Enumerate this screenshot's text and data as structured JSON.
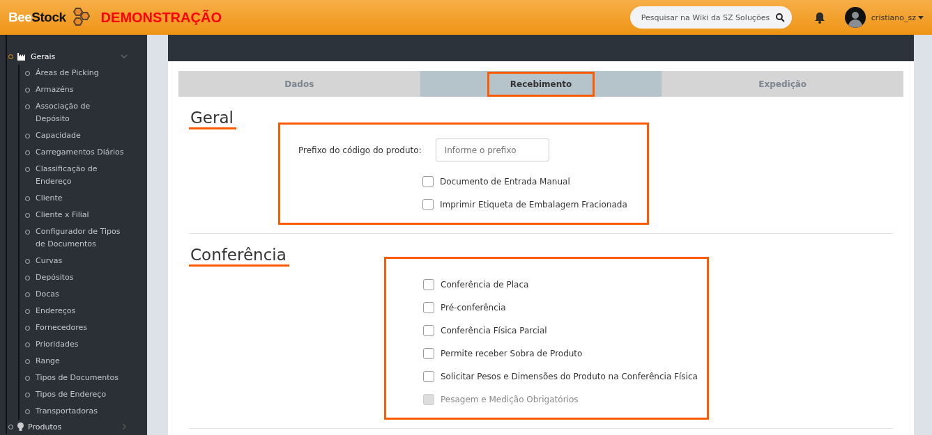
{
  "header": {
    "logo_light": "Bee",
    "logo_dark": "Stock",
    "banner": "DEMONSTRAÇÃO",
    "search": {
      "placeholder": "Pesquisar na Wiki da SZ Soluções"
    },
    "user": "cristiano_sz"
  },
  "sidebar": {
    "group": {
      "label": "Gerais",
      "expanded": true,
      "children": [
        {
          "label": "Áreas de Picking"
        },
        {
          "label": "Armazéns"
        },
        {
          "label": "Associação de Depósito"
        },
        {
          "label": "Capacidade"
        },
        {
          "label": "Carregamentos Diários"
        },
        {
          "label": "Classificação de Endereço"
        },
        {
          "label": "Cliente"
        },
        {
          "label": "Cliente x Filial"
        },
        {
          "label": "Configurador de Tipos de Documentos"
        },
        {
          "label": "Curvas"
        },
        {
          "label": "Depósitos"
        },
        {
          "label": "Docas"
        },
        {
          "label": "Endereços"
        },
        {
          "label": "Fornecedores"
        },
        {
          "label": "Prioridades"
        },
        {
          "label": "Range"
        },
        {
          "label": "Tipos de Documentos"
        },
        {
          "label": "Tipos de Endereço"
        },
        {
          "label": "Transportadoras"
        }
      ]
    },
    "next": {
      "label": "Produtos",
      "expanded": false
    }
  },
  "tabs": [
    {
      "label": "Dados",
      "selected": false,
      "highlighted": false
    },
    {
      "label": "Recebimento",
      "selected": true,
      "highlighted": true
    },
    {
      "label": "Expedição",
      "selected": false,
      "highlighted": false
    }
  ],
  "sections": [
    {
      "title": "Geral",
      "highlighted": true,
      "field": {
        "label": "Prefixo do código do produto:",
        "placeholder": "Informe o prefixo"
      },
      "options": [
        {
          "label": "Documento de Entrada Manual",
          "checked": false,
          "disabled": false
        },
        {
          "label": "Imprimir Etiqueta de Embalagem Fracionada",
          "checked": false,
          "disabled": false
        }
      ]
    },
    {
      "title": "Conferência",
      "highlighted": true,
      "options": [
        {
          "label": "Conferência de Placa",
          "checked": false,
          "disabled": false
        },
        {
          "label": "Pré-conferência",
          "checked": false,
          "disabled": false
        },
        {
          "label": "Conferência Física Parcial",
          "checked": false,
          "disabled": false
        },
        {
          "label": "Permite receber Sobra de Produto",
          "checked": false,
          "disabled": false
        },
        {
          "label": "Solicitar Pesos e Dimensões do Produto na Conferência Física",
          "checked": false,
          "disabled": false
        },
        {
          "label": "Pesagem e Medição Obrigatórios",
          "checked": false,
          "disabled": true
        }
      ]
    }
  ]
}
